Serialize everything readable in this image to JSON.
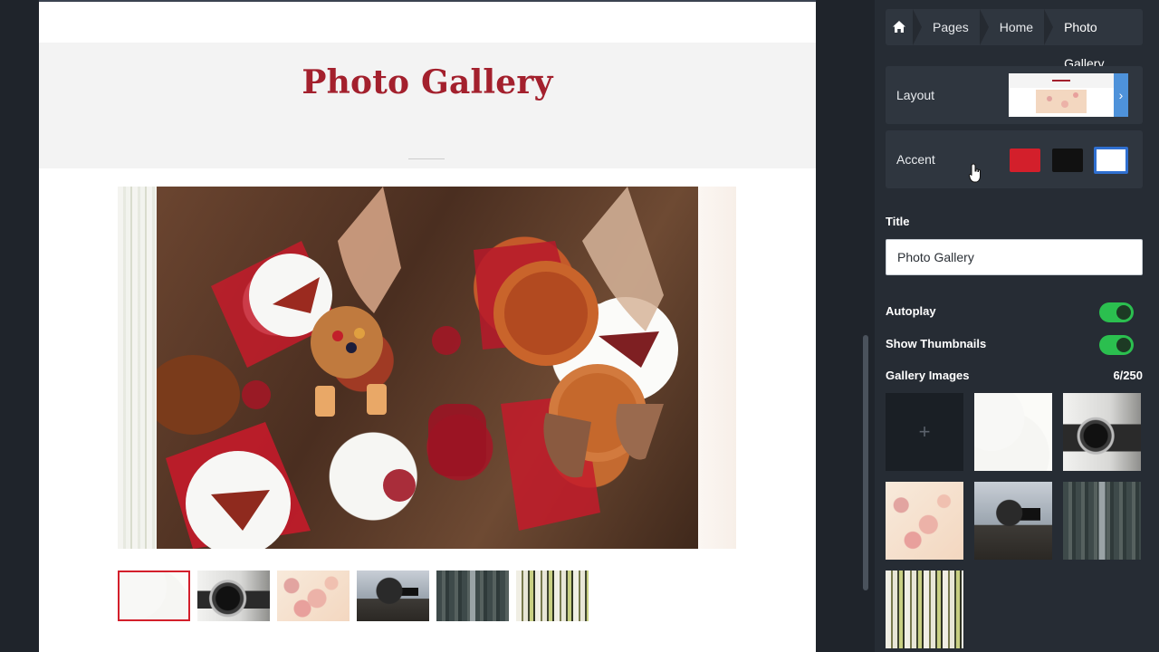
{
  "preview": {
    "page_title": "Photo Gallery",
    "main_image": "food-table-photo",
    "thumbnails": [
      {
        "name": "food-table-photo",
        "active": true
      },
      {
        "name": "camera-photo",
        "active": false
      },
      {
        "name": "petals-photo",
        "active": false
      },
      {
        "name": "photographer-photo",
        "active": false
      },
      {
        "name": "forest-road-photo",
        "active": false
      },
      {
        "name": "birch-trees-photo",
        "active": false
      }
    ]
  },
  "panel": {
    "breadcrumb": {
      "home_icon": "home-icon",
      "items": [
        "Pages",
        "Home",
        "Photo Gallery"
      ]
    },
    "layout_label": "Layout",
    "accent": {
      "label": "Accent",
      "swatches": [
        "#d31f2b",
        "#111111",
        "#ffffff"
      ],
      "selected_index": 2
    },
    "title_section": {
      "label": "Title",
      "value": "Photo Gallery"
    },
    "autoplay": {
      "label": "Autoplay",
      "on": true
    },
    "show_thumbnails": {
      "label": "Show Thumbnails",
      "on": true
    },
    "gallery_images": {
      "label": "Gallery Images",
      "count": "6/250",
      "add_label": "+",
      "tiles": [
        "food-table-photo",
        "camera-photo",
        "petals-photo",
        "photographer-photo",
        "forest-road-photo",
        "birch-trees-photo"
      ]
    }
  },
  "colors": {
    "accent_red": "#a3202d",
    "toggle_green": "#2bbf4f",
    "layout_arrow_blue": "#4e92da"
  }
}
